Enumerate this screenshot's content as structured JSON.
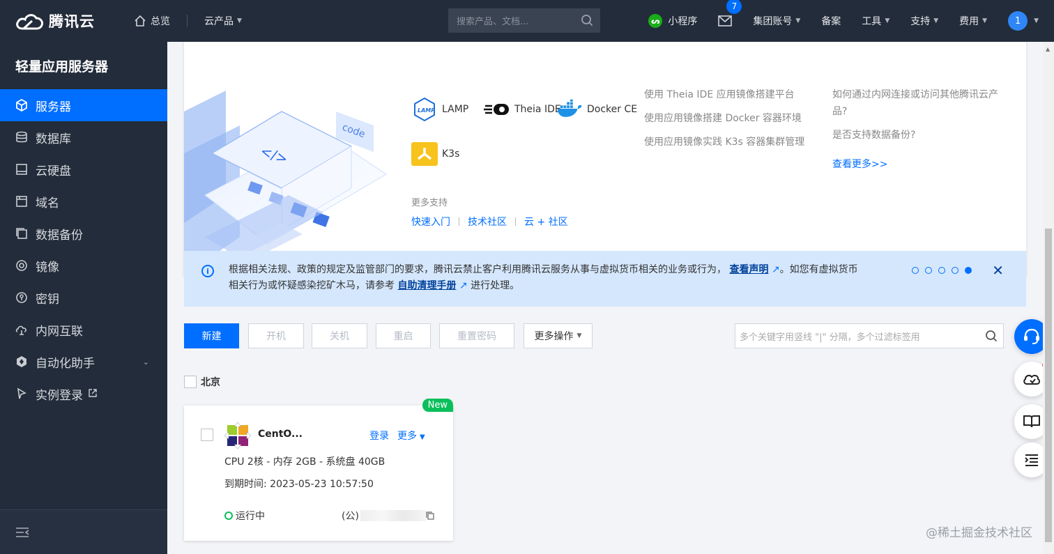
{
  "topnav": {
    "brand": "腾讯云",
    "home": "总览",
    "products": "云产品",
    "search_placeholder": "搜索产品、文档...",
    "mini_program": "小程序",
    "mail_badge": "7",
    "group_account": "集团账号",
    "beian": "备案",
    "tools": "工具",
    "support": "支持",
    "billing": "费用",
    "avatar": "1"
  },
  "sidebar": {
    "title": "轻量应用服务器",
    "items": [
      {
        "label": "服务器",
        "icon": "cube-icon"
      },
      {
        "label": "数据库",
        "icon": "database-icon"
      },
      {
        "label": "云硬盘",
        "icon": "disk-icon"
      },
      {
        "label": "域名",
        "icon": "domain-icon"
      },
      {
        "label": "数据备份",
        "icon": "backup-icon"
      },
      {
        "label": "镜像",
        "icon": "image-icon"
      },
      {
        "label": "密钥",
        "icon": "key-icon"
      },
      {
        "label": "内网互联",
        "icon": "network-icon"
      },
      {
        "label": "自动化助手",
        "icon": "automation-icon"
      },
      {
        "label": "实例登录",
        "icon": "login-icon"
      }
    ]
  },
  "banner": {
    "apps": [
      "LAMP",
      "Theia IDE",
      "Docker CE",
      "K3s"
    ],
    "more_support": "更多支持",
    "links": [
      "快速入门",
      "技术社区",
      "云 + 社区"
    ],
    "docs": [
      "使用 Theia IDE 应用镜像搭建平台",
      "使用应用镜像搭建 Docker 容器环境",
      "使用应用镜像实践 K3s 容器集群管理"
    ],
    "faq": [
      "如何通过内网连接或访问其他腾讯云产品?",
      "是否支持数据备份?"
    ],
    "faq_more": "查看更多>>",
    "code_label": "code",
    "tag_label": "</>"
  },
  "notice": {
    "line1_a": "根据相关法规、政策的规定及监管部门的要求，腾讯云禁止客户利用腾讯云服务从事与虚拟货币相关的业务或行为，",
    "link1": "查看声明",
    "line1_b": "。如您有虚拟货币",
    "line2_a": "相关行为或怀疑感染挖矿木马，请参考",
    "link2": "自助清理手册",
    "line2_b": "进行处理。",
    "active_dot": 5,
    "total_dots": 5
  },
  "toolbar": {
    "new": "新建",
    "start": "开机",
    "stop": "关机",
    "restart": "重启",
    "reset_pwd": "重置密码",
    "more_ops": "更多操作",
    "search_placeholder": "多个关键字用竖线 \"|\" 分隔，多个过滤标签用"
  },
  "region": "北京",
  "instance": {
    "badge": "New",
    "name": "CentO...",
    "login": "登录",
    "more": "更多",
    "spec": "CPU 2核 - 内存 2GB - 系统盘 40GB",
    "expire_label": "到期时间:",
    "expire_value": "2023-05-23 10:57:50",
    "status": "运行中",
    "ip_label": "(公)"
  },
  "watermark": "@稀土掘金技术社区",
  "colors": {
    "primary": "#006eff",
    "nav_bg": "#232c3a",
    "success": "#0abf5b"
  }
}
